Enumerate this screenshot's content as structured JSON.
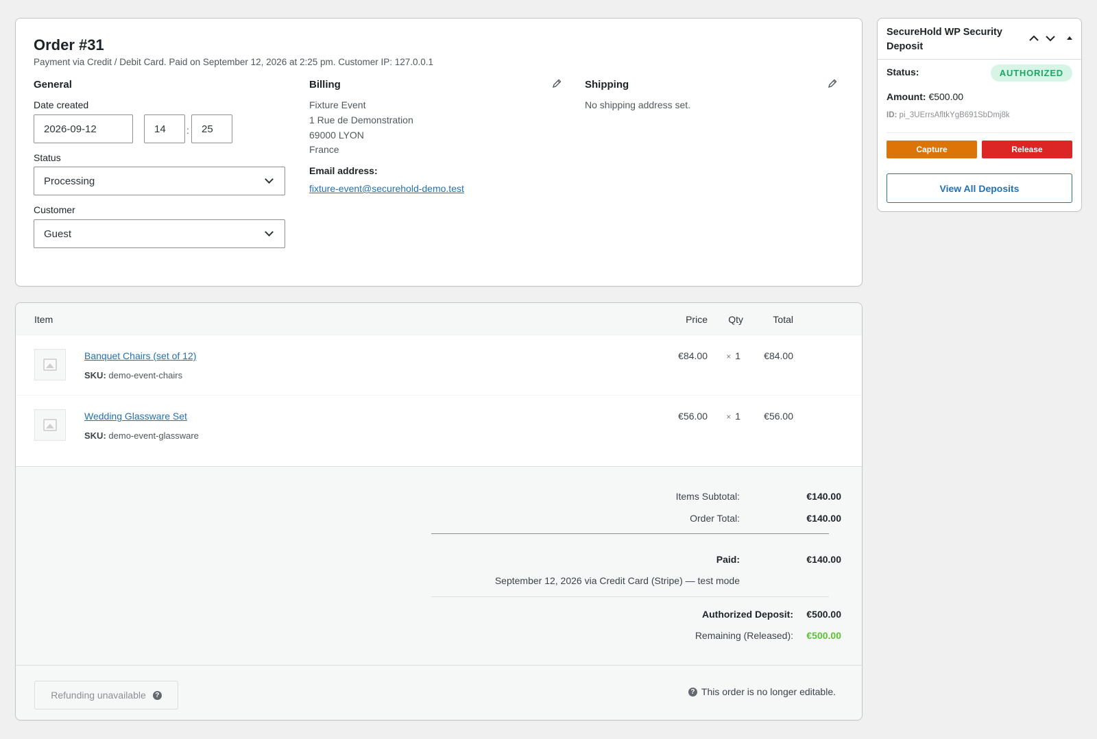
{
  "order": {
    "title": "Order #31",
    "meta": "Payment via Credit / Debit Card. Paid on September 12, 2026 at 2:25 pm. Customer IP: 127.0.0.1",
    "general": {
      "heading": "General",
      "date_label": "Date created",
      "date_value": "2026-09-12",
      "hour_value": "14",
      "minute_value": "25",
      "time_separator": ":",
      "status_label": "Status",
      "status_value": "Processing",
      "customer_label": "Customer",
      "customer_value": "Guest"
    },
    "billing": {
      "heading": "Billing",
      "address_lines": [
        "Fixture Event",
        "1 Rue de Demonstration",
        "69000 LYON",
        "France"
      ],
      "email_label": "Email address:",
      "email": "fixture-event@securehold-demo.test"
    },
    "shipping": {
      "heading": "Shipping",
      "text": "No shipping address set."
    }
  },
  "items": {
    "headers": {
      "item": "Item",
      "price": "Price",
      "qty": "Qty",
      "total": "Total"
    },
    "rows": [
      {
        "name": "Banquet Chairs (set of 12)",
        "sku_label": "SKU:",
        "sku": "demo-event-chairs",
        "price": "€84.00",
        "qty_prefix": "×",
        "qty": "1",
        "total": "€84.00"
      },
      {
        "name": "Wedding Glassware Set",
        "sku_label": "SKU:",
        "sku": "demo-event-glassware",
        "price": "€56.00",
        "qty_prefix": "×",
        "qty": "1",
        "total": "€56.00"
      }
    ]
  },
  "totals": {
    "subtotal_label": "Items Subtotal:",
    "subtotal_value": "€140.00",
    "order_total_label": "Order Total:",
    "order_total_value": "€140.00",
    "paid_label": "Paid:",
    "paid_value": "€140.00",
    "paid_note": "September 12, 2026 via Credit Card (Stripe) — test mode",
    "deposit_label": "Authorized Deposit:",
    "deposit_value": "€500.00",
    "remaining_label": "Remaining (Released):",
    "remaining_value": "€500.00"
  },
  "footer": {
    "refund_label": "Refunding unavailable",
    "help_glyph": "?",
    "not_editable": "This order is no longer editable."
  },
  "deposit": {
    "title": "SecureHold WP Security Deposit",
    "status_label": "Status:",
    "status_badge": "AUTHORIZED",
    "amount_label": "Amount:",
    "amount_value": "€500.00",
    "id_label": "ID:",
    "id_value": "pi_3UErrsAfltkYgB691SbDmj8k",
    "capture_label": "Capture",
    "release_label": "Release",
    "view_all_label": "View All Deposits"
  },
  "icons": {
    "edit": "pencil-icon",
    "help": "help-icon",
    "move_up": "chevron-up-icon",
    "move_down": "chevron-down-icon",
    "toggle": "caret-up-icon",
    "placeholder": "image-placeholder-icon"
  },
  "colors": {
    "link": "#2271b1",
    "capture": "#dc7407",
    "release": "#dc2626",
    "badge_bg": "#d7f5e7",
    "badge_text": "#1aa863",
    "remaining": "#5bc236"
  }
}
